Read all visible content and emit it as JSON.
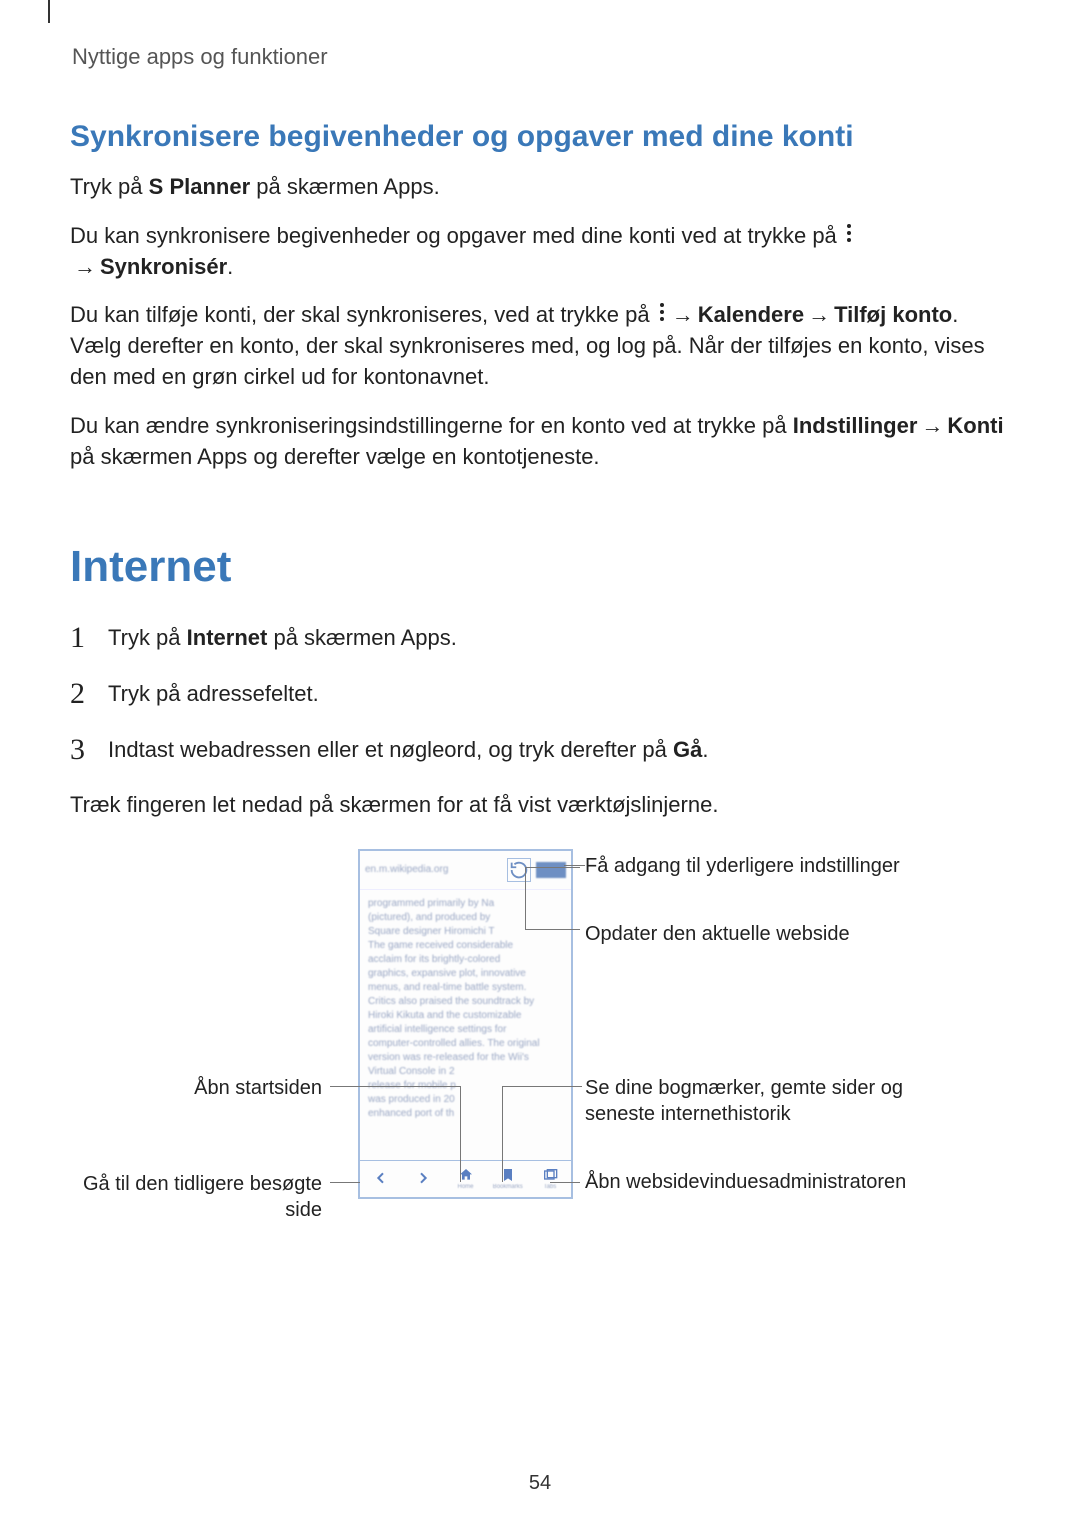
{
  "header": "Nyttige apps og funktioner",
  "section1": {
    "title": "Synkronisere begivenheder og opgaver med dine konti",
    "p1a": "Tryk på ",
    "p1b": "S Planner",
    "p1c": " på skærmen Apps.",
    "p2a": "Du kan synkronisere begivenheder og opgaver med dine konti ved at trykke på ",
    "p2arrow": "→",
    "p2b": "Synkronisér",
    "p2c": ".",
    "p3a": "Du kan tilføje konti, der skal synkroniseres, ved at trykke på ",
    "p3b": "Kalendere",
    "p3c": "Tilføj konto",
    "p3d": ". Vælg derefter en konto, der skal synkroniseres med, og log på. Når der tilføjes en konto, vises den med en grøn cirkel ud for kontonavnet.",
    "p4a": "Du kan ændre synkroniseringsindstillingerne for en konto ved at trykke på ",
    "p4b": "Indstillinger",
    "p4c": "Konti",
    "p4d": " på skærmen Apps og derefter vælge en kontotjeneste."
  },
  "section2": {
    "title": "Internet",
    "step1a": "Tryk på ",
    "step1b": "Internet",
    "step1c": " på skærmen Apps.",
    "step2": "Tryk på adressefeltet.",
    "step3a": "Indtast webadressen eller et nøgleord, og tryk derefter på ",
    "step3b": "Gå",
    "step3c": ".",
    "after": "Træk fingeren let nedad på skærmen for at få vist værktøjslinjerne."
  },
  "callouts": {
    "more": "Få adgang til yderligere indstillinger",
    "refresh": "Opdater den aktuelle webside",
    "home": "Åbn startsiden",
    "back": "Gå til den tidligere besøgte side",
    "bookmarks": "Se dine bogmærker, gemte sider og seneste internethistorik",
    "tabs": "Åbn websidevinduesadministratoren"
  },
  "phone": {
    "url": "en.m.wikipedia.org",
    "lines": [
      "programmed primarily by Na",
      "(pictured), and produced by",
      "Square designer Hiromichi T",
      "The game received considerable",
      "acclaim for its brightly-colored",
      "graphics, expansive plot, innovative",
      "menus, and real-time battle system.",
      "Critics also praised the soundtrack by",
      "Hiroki Kikuta and the customizable",
      "artificial intelligence settings for",
      "computer-controlled allies. The original",
      "version was re-released for the Wii's",
      "Virtual Console in 2",
      "release for mobile p",
      "was produced in 20",
      "enhanced port of th"
    ],
    "toolbar_labels": [
      "",
      "",
      "Home",
      "Bookmarks",
      "Tabs"
    ]
  },
  "page_number": "54"
}
